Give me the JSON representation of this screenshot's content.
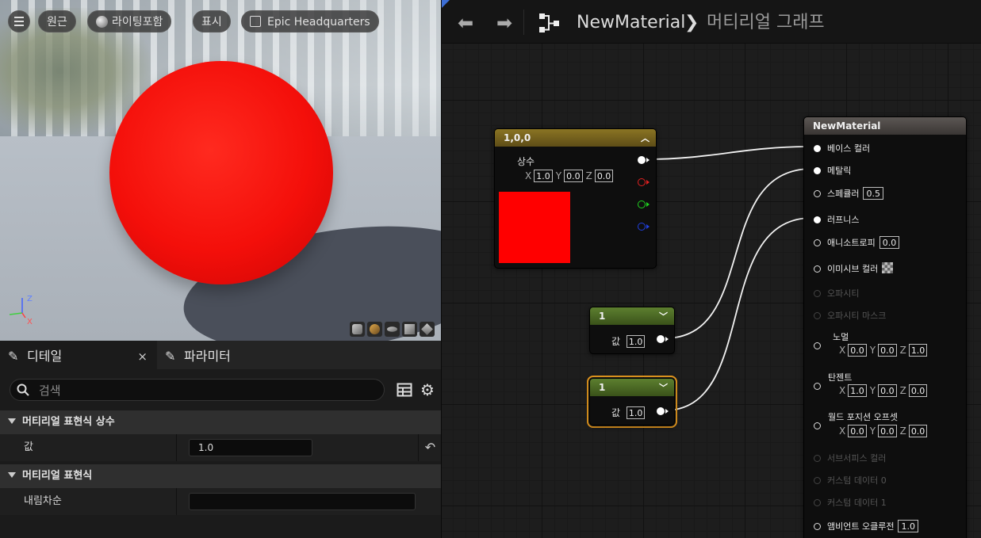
{
  "viewport": {
    "buttons": {
      "original": "원근",
      "lit": "라이팅포함",
      "show": "표시",
      "preview_scene": "Epic Headquarters"
    },
    "axis": {
      "z": "Z",
      "x": "X"
    }
  },
  "details": {
    "tab_details": "디테일",
    "tab_close": "×",
    "tab_parameters": "파라미터",
    "search_placeholder": "검색",
    "section_constant": "머티리얼 표현식 상수",
    "value_label": "값",
    "value": "1.0",
    "reset_icon": "↶",
    "section_expression": "머티리얼 표현식",
    "desc_label": "내림차순",
    "desc_value": ""
  },
  "graph": {
    "asset_name": "NewMaterial",
    "chevron": "❯",
    "graph_name": "머티리얼 그래프",
    "nav_back": "⬅",
    "nav_forward": "➡",
    "const3": {
      "title": "1,0,0",
      "label": "상수",
      "x": "1.0",
      "y": "0.0",
      "z": "0.0",
      "swatch_color": "#ff0000"
    },
    "scalar1": {
      "title": "1",
      "label": "값",
      "value": "1.0"
    },
    "scalar2": {
      "title": "1",
      "label": "값",
      "value": "1.0"
    },
    "result": {
      "title": "NewMaterial",
      "base_color": "베이스 컬러",
      "metallic": "메탈릭",
      "specular": "스페큘러",
      "specular_value": "0.5",
      "roughness": "러프니스",
      "anisotropy": "애니소트로피",
      "anisotropy_value": "0.0",
      "emissive": "이미시브 컬러",
      "opacity": "오파시티",
      "opacity_mask": "오파시티 마스크",
      "normal": "노멀",
      "normal_x": "0.0",
      "normal_y": "0.0",
      "normal_z": "1.0",
      "tangent": "탄젠트",
      "tangent_x": "1.0",
      "tangent_y": "0.0",
      "tangent_z": "0.0",
      "wpo": "월드 포지션 오프셋",
      "wpo_x": "0.0",
      "wpo_y": "0.0",
      "wpo_z": "0.0",
      "subsurface": "서브서피스 컬러",
      "custom0": "커스텀 데이터 0",
      "custom1": "커스텀 데이터 1",
      "ao": "앰비언트 오클루전",
      "ao_value": "1.0"
    },
    "axis_labels": {
      "x": "X",
      "y": "Y",
      "z": "Z"
    }
  },
  "colors": {
    "sphere": "#f40f0a",
    "selection_outline": "#f0a020",
    "constant_header": "#8a7423",
    "scalar_header": "#5d7f2f",
    "result_header": "#5c5754",
    "pin_red": "#e02020",
    "pin_green": "#20d020",
    "pin_blue": "#2040e0"
  }
}
